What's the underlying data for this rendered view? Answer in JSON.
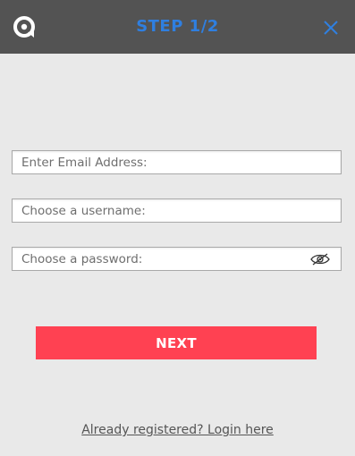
{
  "header": {
    "logo_icon": "chat-bubble-logo-icon",
    "title": "STEP 1/2",
    "close_icon": "close-icon",
    "title_color": "#2f7fe0",
    "background": "#535353"
  },
  "form": {
    "email_placeholder": "Enter Email Address:",
    "username_placeholder": "Choose a username:",
    "password_placeholder": "Choose a password:",
    "show_password_icon": "eye-icon"
  },
  "actions": {
    "next_label": "NEXT",
    "next_color": "#ff4152",
    "login_link": "Already registered? Login here"
  }
}
